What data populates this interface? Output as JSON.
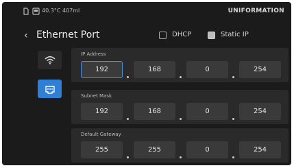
{
  "status_bar": {
    "readout": "40.3°C 407ml",
    "brand": "UNIFORMATION"
  },
  "header": {
    "title": "Ethernet Port",
    "modes": [
      {
        "label": "DHCP",
        "checked": false
      },
      {
        "label": "Static IP",
        "checked": true
      }
    ]
  },
  "sidebar": {
    "tabs": [
      {
        "icon": "wifi-icon",
        "active": false
      },
      {
        "icon": "ethernet-icon",
        "active": true
      }
    ]
  },
  "fields": [
    {
      "label": "IP Address",
      "octets": [
        "192",
        "168",
        "0",
        "254"
      ]
    },
    {
      "label": "Subnet Mask",
      "octets": [
        "192",
        "168",
        "0",
        "254"
      ]
    },
    {
      "label": "Default Gateway",
      "octets": [
        "255",
        "255",
        "0",
        "254"
      ]
    }
  ],
  "colors": {
    "background": "#1b1b1b",
    "panel": "#2a2a2a",
    "accent": "#2f7fd6"
  }
}
